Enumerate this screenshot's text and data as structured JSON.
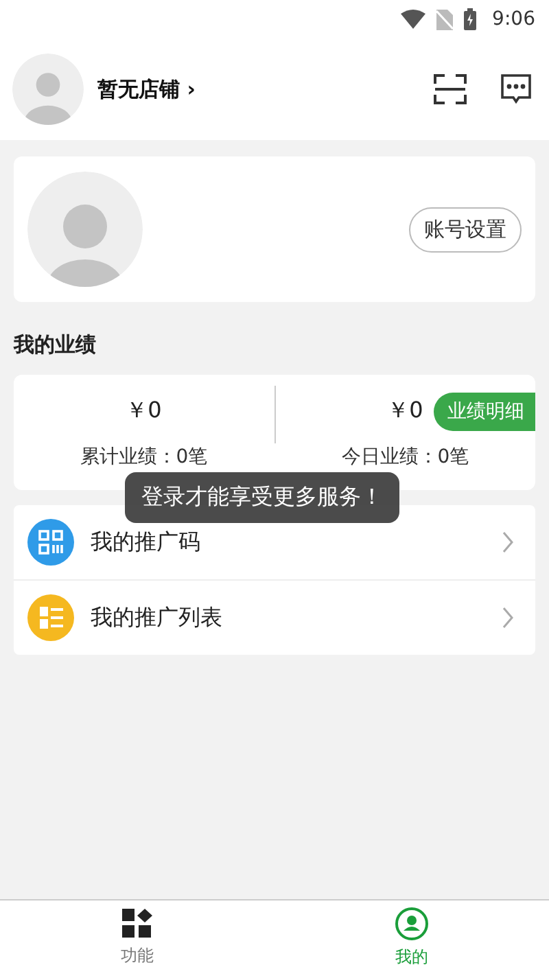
{
  "status_bar": {
    "time": "9:06"
  },
  "header": {
    "store_label": "暂无店铺",
    "chevron": "›"
  },
  "profile_card": {
    "account_button": "账号设置"
  },
  "performance": {
    "title": "我的业绩",
    "detail_button": "业绩明细",
    "stats": [
      {
        "amount": "￥0",
        "label": "累计业绩：0笔"
      },
      {
        "amount": "￥0",
        "label": "今日业绩：0笔"
      }
    ]
  },
  "menu": [
    {
      "kind": "qrcode",
      "label": "我的推广码",
      "color": "#2f9be8"
    },
    {
      "kind": "list",
      "label": "我的推广列表",
      "color": "#f5b820"
    }
  ],
  "toast": "登录才能享受更多服务！",
  "tabs": [
    {
      "kind": "grid",
      "label": "功能",
      "selected": false
    },
    {
      "kind": "user",
      "label": "我的",
      "selected": true
    }
  ]
}
